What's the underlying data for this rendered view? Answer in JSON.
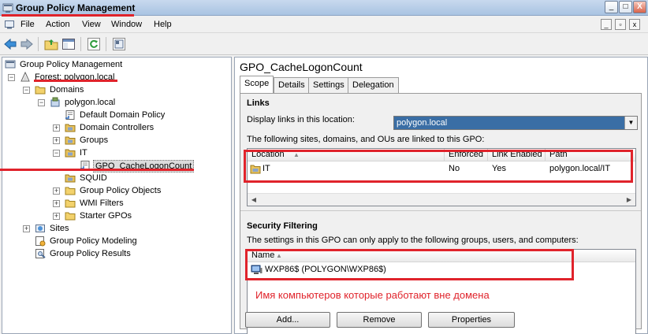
{
  "window": {
    "title": "Group Policy Management",
    "buttons": {
      "minimize": "_",
      "maximize": "□",
      "close": "X"
    }
  },
  "menu": {
    "items": [
      "File",
      "Action",
      "View",
      "Window",
      "Help"
    ],
    "mdi": {
      "minimize": "_",
      "restore": "▫",
      "close": "x"
    }
  },
  "tree": {
    "nodes": [
      {
        "label": "Group Policy Management",
        "icon": "gpm-icon"
      },
      {
        "label": "Forest: polygon.local",
        "icon": "forest-icon",
        "expander": "−"
      },
      {
        "label": "Domains",
        "icon": "folder-icon",
        "expander": "−"
      },
      {
        "label": "polygon.local",
        "icon": "domain-icon",
        "expander": "−"
      },
      {
        "label": "Default Domain Policy",
        "icon": "gpo-link-icon"
      },
      {
        "label": "Domain Controllers",
        "icon": "ou-icon",
        "expander": "+"
      },
      {
        "label": "Groups",
        "icon": "ou-icon",
        "expander": "+"
      },
      {
        "label": "IT",
        "icon": "ou-icon",
        "expander": "−"
      },
      {
        "label": "GPO_CacheLogonCount",
        "icon": "gpo-link-icon",
        "selected": true
      },
      {
        "label": "SQUID",
        "icon": "ou-icon"
      },
      {
        "label": "Group Policy Objects",
        "icon": "folder-icon",
        "expander": "+"
      },
      {
        "label": "WMI Filters",
        "icon": "folder-icon",
        "expander": "+"
      },
      {
        "label": "Starter GPOs",
        "icon": "folder-icon",
        "expander": "+"
      },
      {
        "label": "Sites",
        "icon": "sites-icon",
        "expander": "+"
      },
      {
        "label": "Group Policy Modeling",
        "icon": "modeling-icon"
      },
      {
        "label": "Group Policy Results",
        "icon": "results-icon"
      }
    ]
  },
  "gpo": {
    "title": "GPO_CacheLogonCount",
    "tabs": [
      "Scope",
      "Details",
      "Settings",
      "Delegation"
    ],
    "active_tab": "Scope",
    "links": {
      "heading": "Links",
      "display_label": "Display links in this location:",
      "location_value": "polygon.local",
      "description": "The following sites, domains, and OUs are linked to this GPO:",
      "columns": [
        "Location",
        "Enforced",
        "Link Enabled",
        "Path"
      ],
      "rows": [
        {
          "location": "IT",
          "enforced": "No",
          "link_enabled": "Yes",
          "path": "polygon.local/IT"
        }
      ]
    },
    "security": {
      "heading": "Security Filtering",
      "description": "The settings in this GPO can only apply to the following groups, users, and computers:",
      "column": "Name",
      "rows": [
        {
          "name": "WXP86$ (POLYGON\\WXP86$)"
        }
      ],
      "buttons": {
        "add": "Add...",
        "remove": "Remove",
        "properties": "Properties"
      }
    }
  },
  "annotation": {
    "text": "Имя компьютеров которые работают вне домена",
    "color": "#e0232b"
  },
  "colors": {
    "selection": "#3a6ea5",
    "annotation": "#e0232b"
  },
  "scroll_arrows": {
    "left": "◀",
    "right": "▶"
  },
  "sort_indicator": "▲"
}
